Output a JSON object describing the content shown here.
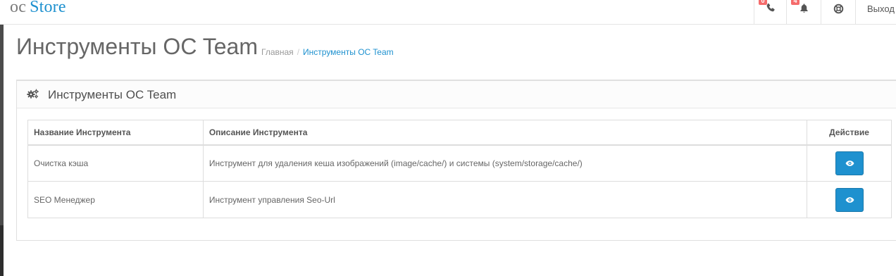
{
  "header": {
    "logo": {
      "oc": "oc",
      "store": "Store"
    },
    "phone": {
      "icon": "phone-icon",
      "badge": "0"
    },
    "notifications": {
      "icon": "bell-icon",
      "badge": "4"
    },
    "help": {
      "icon": "life-ring-icon"
    },
    "logout_label": "Выход"
  },
  "page": {
    "title": "Инструменты OC Team",
    "breadcrumb": [
      "Главная",
      "Инструменты OC Team"
    ]
  },
  "panel": {
    "icon": "cogs-icon",
    "title": "Инструменты OC Team"
  },
  "table": {
    "headers": [
      "Название Инструмента",
      "Описание Инструмента",
      "Действие"
    ],
    "rows": [
      {
        "name": "Очистка кэша",
        "description": "Инструмент для удаления кеша изображений (image/cache/) и системы (system/storage/cache/)",
        "action_icon": "eye-icon"
      },
      {
        "name": "SEO Менеджер",
        "description": "Инструмент управления Seo-Url",
        "action_icon": "eye-icon"
      }
    ]
  },
  "colors": {
    "primary": "#1e91cf",
    "badge": "#f56b6b",
    "sidebar": "#4b4b4b"
  }
}
